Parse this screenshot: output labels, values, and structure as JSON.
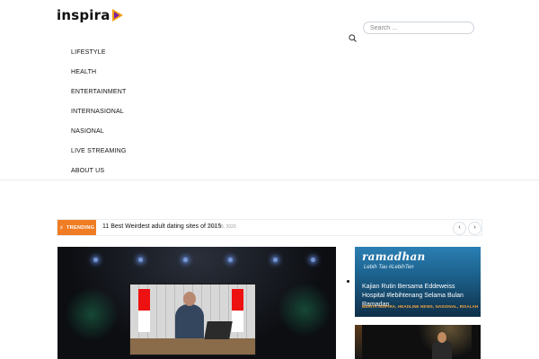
{
  "brand": {
    "name": "inspira"
  },
  "search": {
    "placeholder": "Search ..."
  },
  "nav": {
    "items": [
      {
        "label": "LIFESTYLE"
      },
      {
        "label": "HEALTH"
      },
      {
        "label": "ENTERTAINMENT"
      },
      {
        "label": "INTERNASIONAL"
      },
      {
        "label": "NASIONAL"
      },
      {
        "label": "LIVE STREAMING"
      },
      {
        "label": "ABOUT US"
      }
    ]
  },
  "trending": {
    "badge_label": "TRENDING",
    "title": "11 Best Weirdest adult dating sites of 2015",
    "date": "June 15, 2023",
    "prev_icon": "chevron-left-icon",
    "next_icon": "chevron-right-icon",
    "accent": "#f07c23"
  },
  "side_cards": [
    {
      "image_text": "ramadhan",
      "image_subtext": "Lebih Tau #LebihTen",
      "title": "Kajian Rutin Bersama Eddeweiss Hospital #lebihtenang Selama Bulan Ramadan",
      "categories": "BERITA INSPIRA, HEADLINE NEWS, NASIONAL, RISALAH"
    }
  ]
}
